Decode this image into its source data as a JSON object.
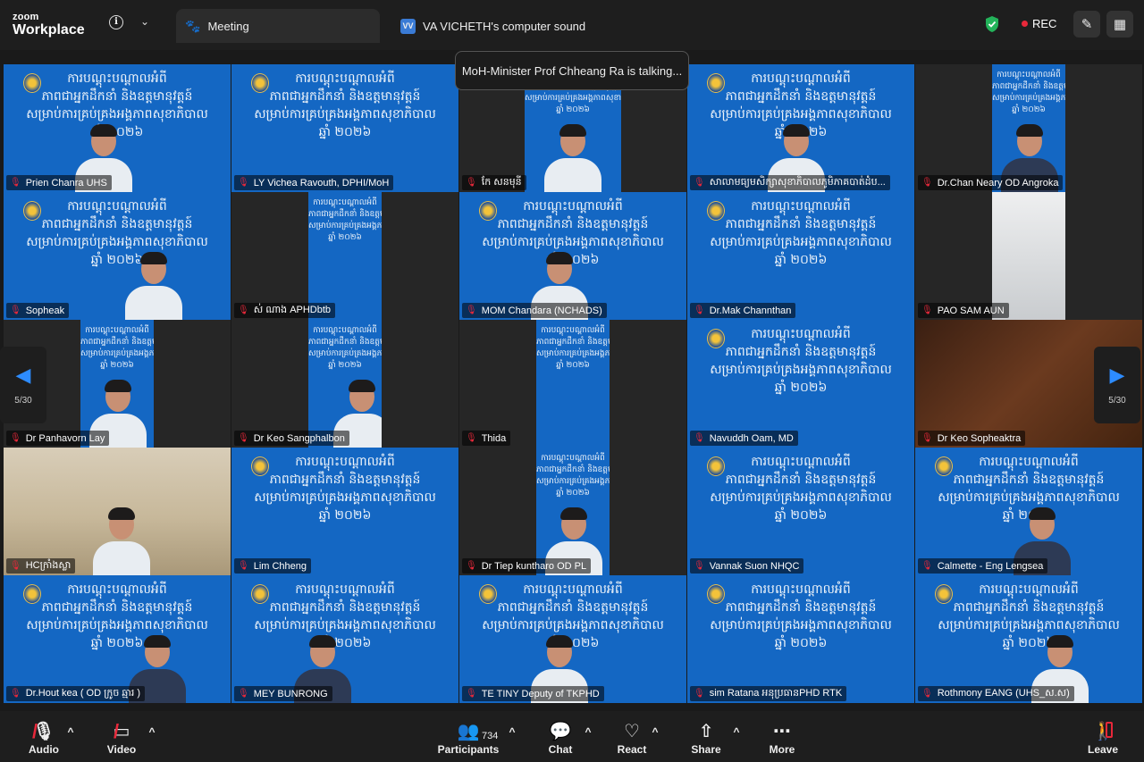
{
  "app": {
    "brand_small": "zoom",
    "brand_big": "Workplace"
  },
  "tabs": [
    {
      "label": "Meeting",
      "icon": "paw-icon"
    },
    {
      "label": "VA VICHETH's computer sound",
      "icon_text": "VV"
    }
  ],
  "status": {
    "rec_label": "REC",
    "security": "shield-icon"
  },
  "toast": "MoH-Minister Prof Chheang Ra is talking...",
  "banner_lines": [
    "ការបណ្តុះបណ្តាលអំពី",
    "ភាពជាអ្នកដឹកនាំ និងឧត្តមានុវត្តន៍",
    "សម្រាប់ការគ្រប់គ្រងអង្គភាពសុខាភិបាល",
    "ឆ្នាំ ២០២៦"
  ],
  "pager": {
    "left_count": "5/30",
    "right_count": "5/30"
  },
  "participants": [
    {
      "name": "Prien Chanra  UHS",
      "muted": true
    },
    {
      "name": "LY Vichea Ravouth, DPHI/MoH",
      "muted": true
    },
    {
      "name": "កែ សនមុនី",
      "muted": true
    },
    {
      "name": "សាលាមធ្យមសិក្សាសុខាភិបាលភូមិភាគបាត់ដំប...",
      "muted": true
    },
    {
      "name": "Dr.Chan Neary OD Angroka",
      "muted": true
    },
    {
      "name": "Sopheak",
      "muted": true
    },
    {
      "name": "ស់ ណាង APHDbtb",
      "muted": true
    },
    {
      "name": "MOM Chandara (NCHADS)",
      "muted": true
    },
    {
      "name": "Dr.Mak Channthan",
      "muted": true
    },
    {
      "name": "PAO SAM AUN",
      "muted": true
    },
    {
      "name": "Dr Panhavorn Lay",
      "muted": true
    },
    {
      "name": "Dr Keo Sangphalbon",
      "muted": true
    },
    {
      "name": "Thida",
      "muted": true
    },
    {
      "name": "Navuddh Oam, MD",
      "muted": true
    },
    {
      "name": "Dr Keo Sopheaktra",
      "muted": true
    },
    {
      "name": "HCក្រាំងស្លា",
      "muted": true
    },
    {
      "name": "Lim Chheng",
      "muted": true
    },
    {
      "name": "Dr Tiep kuntharo OD PL",
      "muted": true
    },
    {
      "name": "Vannak Suon NHQC",
      "muted": true
    },
    {
      "name": "Calmette - Eng Lengsea",
      "muted": true
    },
    {
      "name": "Dr.Hout kea  ( OD   ក្រូច ឆ្មារ )",
      "muted": true
    },
    {
      "name": "MEY BUNRONG",
      "muted": true
    },
    {
      "name": "TE TINY Deputy of TKPHD",
      "muted": true
    },
    {
      "name": "sim Ratana អនុប្រធានPHD RTK",
      "muted": true
    },
    {
      "name": "Rothmony EANG (UHS_ស.ស)",
      "muted": true
    }
  ],
  "toolbar": {
    "audio": "Audio",
    "video": "Video",
    "participants": "Participants",
    "participants_count": "734",
    "chat": "Chat",
    "react": "React",
    "share": "Share",
    "more": "More",
    "leave": "Leave"
  }
}
